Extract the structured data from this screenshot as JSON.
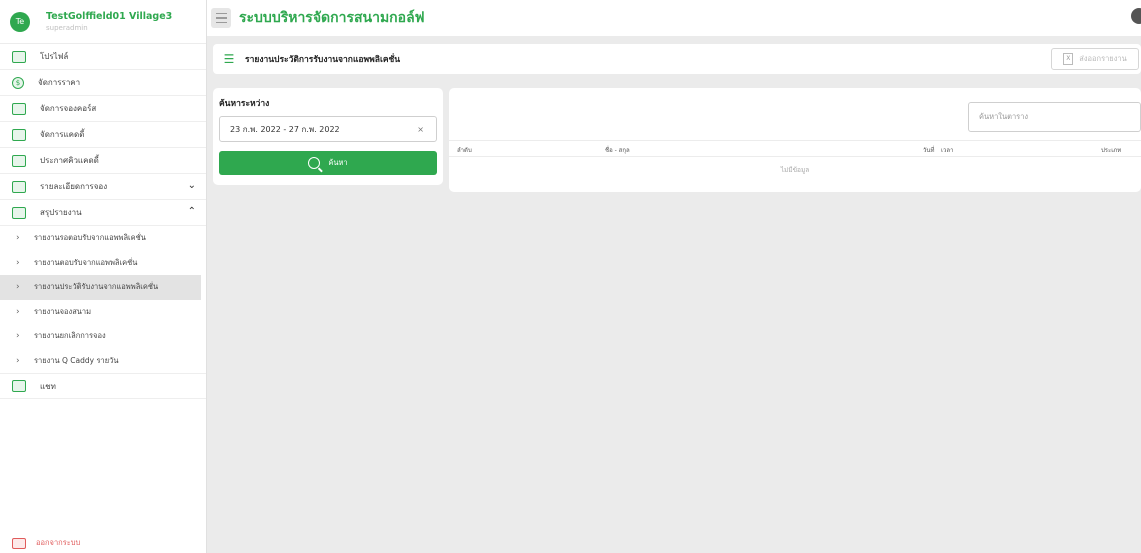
{
  "brand": {
    "avatar_initials": "Te",
    "name": "TestGolffield01 Village3",
    "role": "superadmin",
    "accent_color": "#2fa84f"
  },
  "topbar": {
    "title": "ระบบบริหารจัดการสนามกอล์ฟ",
    "menu_icon": "hamburger-icon",
    "theme_icon": "moon-icon"
  },
  "sidebar": {
    "items": [
      {
        "label": "โปรไฟล์",
        "icon": "profile-icon"
      },
      {
        "label": "จัดการราคา",
        "icon": "price-icon"
      },
      {
        "label": "จัดการจองคอร์ส",
        "icon": "course-icon"
      },
      {
        "label": "จัดการแคดดี้",
        "icon": "caddy-icon"
      },
      {
        "label": "ประกาศคิวแคดดี้",
        "icon": "announce-icon"
      },
      {
        "label": "รายละเอียดการจอง",
        "icon": "booking-detail-icon"
      },
      {
        "label": "สรุปรายงาน",
        "icon": "report-icon"
      }
    ],
    "report_subitems": [
      "รายงานรอตอบรับจากแอพพลิเคชั่น",
      "รายงานตอบรับจากแอพพลิเคชั่น",
      "รายงานประวัติรับงานจากแอพพลิเคชั่น",
      "รายงานจองสนาม",
      "รายงานยกเลิกการจอง",
      "รายงาน Q Caddy รายวัน"
    ],
    "chat_label": "แชท",
    "logout_label": "ออกจากระบบ"
  },
  "page": {
    "title": "รายงานประวัติการรับงานจากแอพพลิเคชั่น",
    "export_label": "ส่งออกรายงาน"
  },
  "search": {
    "label": "ค้นหาระหว่าง",
    "date_range": "23 ก.พ. 2022 - 27 ก.พ. 2022",
    "clear": "×",
    "button_label": "ค้นหา"
  },
  "table": {
    "search_placeholder": "ค้นหาในตาราง",
    "columns": [
      "ลำดับ",
      "ชื่อ - สกุล",
      "วันที่",
      "เวลา",
      "ประเภท"
    ],
    "empty_text": "ไม่มีข้อมูล"
  }
}
